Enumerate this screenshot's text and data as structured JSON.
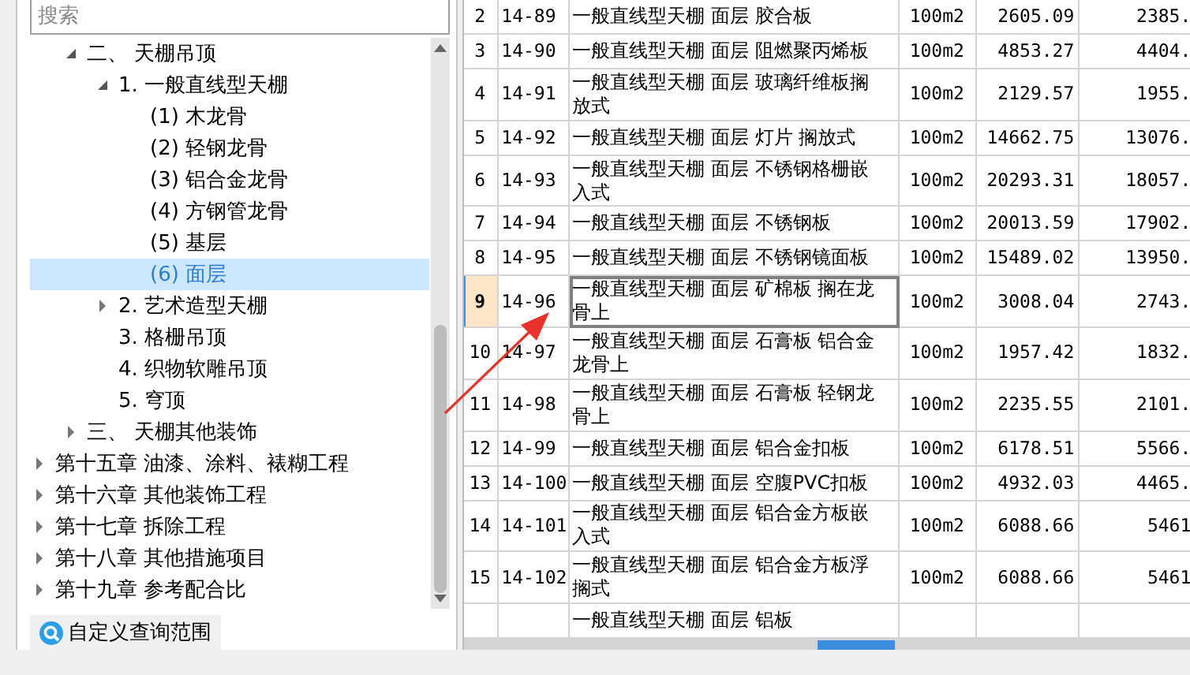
{
  "search": {
    "placeholder": "搜索"
  },
  "tree": [
    {
      "children": [
        {
          "label": "二、 天棚吊顶",
          "expanded": true,
          "selected": false,
          "children": [
            {
              "label": "1. 一般直线型天棚",
              "expanded": true,
              "selected": false,
              "children": [
                {
                  "label": "(1) 木龙骨",
                  "selected": false
                },
                {
                  "label": "(2) 轻钢龙骨",
                  "selected": false
                },
                {
                  "label": "(3) 铝合金龙骨",
                  "selected": false
                },
                {
                  "label": "(4) 方钢管龙骨",
                  "selected": false
                },
                {
                  "label": "(5) 基层",
                  "selected": false
                },
                {
                  "label": "(6) 面层",
                  "selected": true
                }
              ]
            },
            {
              "label": "2. 艺术造型天棚",
              "expanded": false,
              "selected": false
            },
            {
              "label": "3. 格栅吊顶",
              "selected": false
            },
            {
              "label": "4. 织物软雕吊顶",
              "selected": false
            },
            {
              "label": "5. 穹顶",
              "selected": false
            }
          ]
        },
        {
          "label": "三、 天棚其他装饰",
          "expanded": false,
          "selected": false
        }
      ]
    },
    {
      "label": "第十五章 油漆、涂料、裱糊工程",
      "expanded": false,
      "selected": false
    },
    {
      "label": "第十六章 其他装饰工程",
      "expanded": false,
      "selected": false
    },
    {
      "label": "第十七章 拆除工程",
      "expanded": false,
      "selected": false
    },
    {
      "label": "第十八章 其他措施项目",
      "expanded": false,
      "selected": false
    },
    {
      "label": "第十九章 参考配合比",
      "expanded": false,
      "selected": false
    }
  ],
  "custom_query_button": {
    "label": "自定义查询范围"
  },
  "table": {
    "rows": [
      {
        "index": "2",
        "code": "14-89",
        "name": "一般直线型天棚 面层 胶合板",
        "unit": "100m2",
        "price": "2605.09",
        "column_6": "2385.",
        "selected": false
      },
      {
        "index": "3",
        "code": "14-90",
        "name": "一般直线型天棚 面层 阻燃聚丙烯板",
        "unit": "100m2",
        "price": "4853.27",
        "column_6": "4404.",
        "selected": false
      },
      {
        "index": "4",
        "code": "14-91",
        "name": "一般直线型天棚 面层 玻璃纤维板搁放式",
        "unit": "100m2",
        "price": "2129.57",
        "column_6": "1955.",
        "selected": false
      },
      {
        "index": "5",
        "code": "14-92",
        "name": "一般直线型天棚 面层 灯片 搁放式",
        "unit": "100m2",
        "price": "14662.75",
        "column_6": "13076.",
        "selected": false
      },
      {
        "index": "6",
        "code": "14-93",
        "name": "一般直线型天棚 面层 不锈钢格栅嵌入式",
        "unit": "100m2",
        "price": "20293.31",
        "column_6": "18057.",
        "selected": false
      },
      {
        "index": "7",
        "code": "14-94",
        "name": "一般直线型天棚 面层 不锈钢板",
        "unit": "100m2",
        "price": "20013.59",
        "column_6": "17902.",
        "selected": false
      },
      {
        "index": "8",
        "code": "14-95",
        "name": "一般直线型天棚 面层 不锈钢镜面板",
        "unit": "100m2",
        "price": "15489.02",
        "column_6": "13950.",
        "selected": false
      },
      {
        "index": "9",
        "code": "14-96",
        "name": "一般直线型天棚 面层 矿棉板 搁在龙骨上",
        "unit": "100m2",
        "price": "3008.04",
        "column_6": "2743.",
        "selected": true
      },
      {
        "index": "10",
        "code": "14-97",
        "name": "一般直线型天棚 面层 石膏板 铝合金龙骨上",
        "unit": "100m2",
        "price": "1957.42",
        "column_6": "1832.",
        "selected": false
      },
      {
        "index": "11",
        "code": "14-98",
        "name": "一般直线型天棚 面层 石膏板 轻钢龙骨上",
        "unit": "100m2",
        "price": "2235.55",
        "column_6": "2101.",
        "selected": false
      },
      {
        "index": "12",
        "code": "14-99",
        "name": "一般直线型天棚 面层 铝合金扣板",
        "unit": "100m2",
        "price": "6178.51",
        "column_6": "5566.",
        "selected": false
      },
      {
        "index": "13",
        "code": "14-100",
        "name": "一般直线型天棚 面层 空腹PVC扣板",
        "unit": "100m2",
        "price": "4932.03",
        "column_6": "4465.",
        "selected": false
      },
      {
        "index": "14",
        "code": "14-101",
        "name": "一般直线型天棚 面层 铝合金方板嵌入式",
        "unit": "100m2",
        "price": "6088.66",
        "column_6": "5461",
        "selected": false
      },
      {
        "index": "15",
        "code": "14-102",
        "name": "一般直线型天棚 面层 铝合金方板浮搁式",
        "unit": "100m2",
        "price": "6088.66",
        "column_6": "5461",
        "selected": false
      },
      {
        "name": "一般直线型天棚 面层 铝板",
        "selected": false
      }
    ]
  }
}
